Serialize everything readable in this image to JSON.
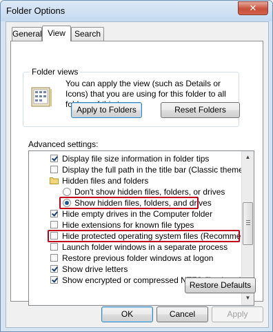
{
  "window": {
    "title": "Folder Options",
    "close_glyph": "✕"
  },
  "tabs": [
    "General",
    "View",
    "Search"
  ],
  "folder_views": {
    "label": "Folder views",
    "description": "You can apply the view (such as Details or Icons) that you are using for this folder to all folders of this type.",
    "apply_button": "Apply to Folders",
    "reset_button": "Reset Folders"
  },
  "advanced": {
    "label": "Advanced settings:",
    "items": [
      {
        "type": "checkbox",
        "checked": true,
        "label": "Display file size information in folder tips"
      },
      {
        "type": "checkbox",
        "checked": false,
        "label": "Display the full path in the title bar (Classic theme only)"
      },
      {
        "type": "folder",
        "label": "Hidden files and folders"
      },
      {
        "type": "radio",
        "checked": false,
        "label": "Don't show hidden files, folders, or drives"
      },
      {
        "type": "radio",
        "checked": true,
        "label": "Show hidden files, folders, and drives"
      },
      {
        "type": "checkbox",
        "checked": true,
        "label": "Hide empty drives in the Computer folder"
      },
      {
        "type": "checkbox",
        "checked": false,
        "label": "Hide extensions for known file types"
      },
      {
        "type": "checkbox",
        "checked": false,
        "label": "Hide protected operating system files (Recommended)"
      },
      {
        "type": "checkbox",
        "checked": false,
        "label": "Launch folder windows in a separate process"
      },
      {
        "type": "checkbox",
        "checked": false,
        "label": "Restore previous folder windows at logon"
      },
      {
        "type": "checkbox",
        "checked": true,
        "label": "Show drive letters"
      },
      {
        "type": "checkbox",
        "checked": true,
        "label": "Show encrypted or compressed NTFS files in color"
      }
    ]
  },
  "restore_defaults": "Restore Defaults",
  "footer": {
    "ok": "OK",
    "cancel": "Cancel",
    "apply": "Apply"
  },
  "colors": {
    "highlight": "#c0001a",
    "title_bg": "#d6e4f2"
  }
}
